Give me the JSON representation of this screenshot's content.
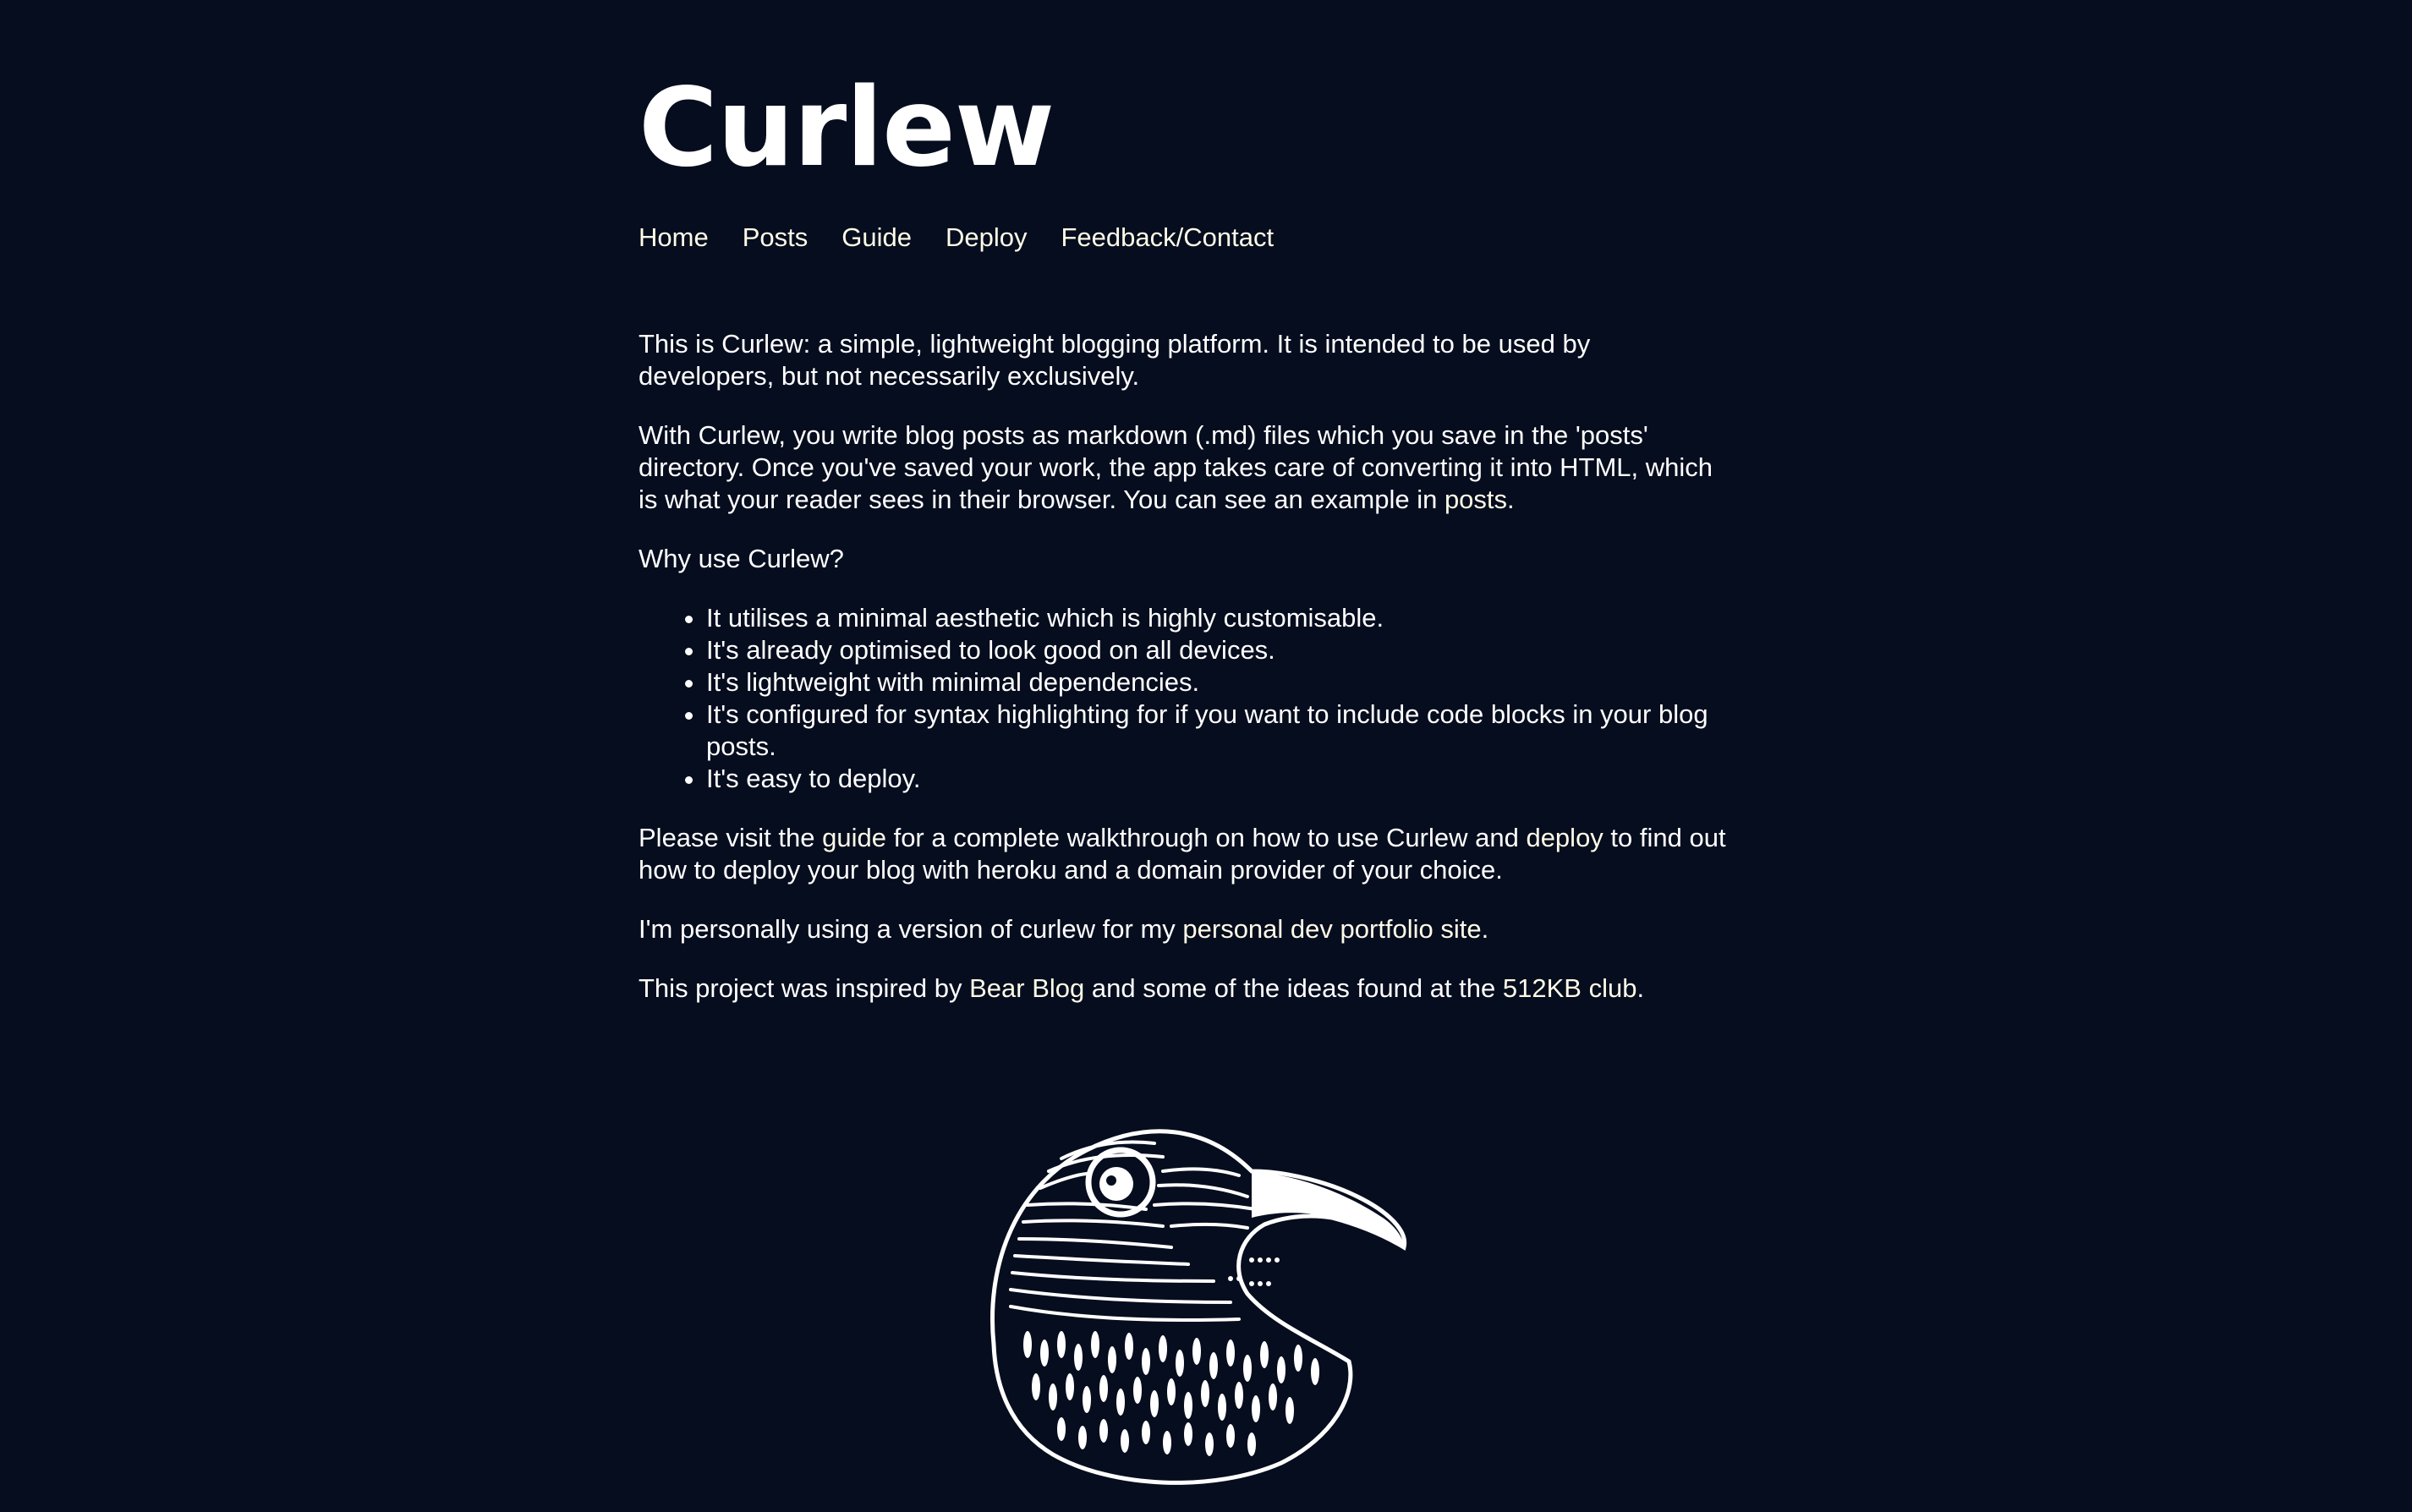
{
  "site": {
    "title": "Curlew"
  },
  "nav": {
    "items": [
      {
        "label": "Home"
      },
      {
        "label": "Posts"
      },
      {
        "label": "Guide"
      },
      {
        "label": "Deploy"
      },
      {
        "label": "Feedback/Contact"
      }
    ]
  },
  "main": {
    "intro": "This is Curlew: a simple, lightweight blogging platform. It is intended to be used by developers, but not necessarily exclusively.",
    "p2_text": "With Curlew, you write blog posts as markdown (.md) files which you save in the 'posts' directory. Once you've saved your work, the app takes care of converting it into HTML, which is what your reader sees in their browser. You can see an example in ",
    "p2_link": "posts",
    "p2_end": ".",
    "why": "Why use Curlew?",
    "bullets": [
      "It utilises a minimal aesthetic which is highly customisable.",
      "It's already optimised to look good on all devices.",
      "It's lightweight with minimal dependencies.",
      "It's configured for syntax highlighting for if you want to include code blocks in your blog posts.",
      "It's easy to deploy."
    ],
    "p4_a": "Please visit the ",
    "p4_link1": "guide",
    "p4_b": " for a complete walkthrough on how to use Curlew and ",
    "p4_link2": "deploy",
    "p4_c": " to find out how to deploy your blog with heroku and a domain provider of your choice.",
    "p5_a": "I'm personally using a version of curlew for my ",
    "p5_link": "personal dev portfolio site",
    "p5_b": ".",
    "p6_a": "This project was inspired by ",
    "p6_link1": "Bear Blog",
    "p6_b": " and some of the ideas found at the ",
    "p6_link2": "512KB club",
    "p6_c": "."
  },
  "colors": {
    "background": "#060d1e",
    "text": "#ffffff",
    "link": "#fffbe8"
  },
  "illustration": {
    "icon": "curlew-bird-illustration"
  }
}
